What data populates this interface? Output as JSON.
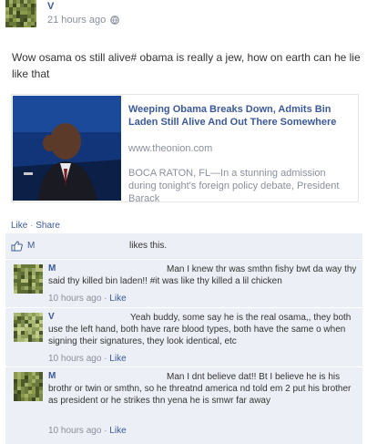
{
  "header": {
    "author": "V",
    "timestamp": "21 hours ago",
    "privacy_icon": "globe-icon"
  },
  "post": {
    "text": "Wow osama os still alive# obama is really a jew, how on earth can he lie like that"
  },
  "attachment": {
    "title": "Weeping Obama Breaks Down, Admits Bin Laden Still Alive And Out There Somewhere",
    "domain": "www.theonion.com",
    "description": "BOCA RATON, FL—In a stunning admission during tonight's foreign policy debate, President Barack"
  },
  "actions": {
    "like": "Like",
    "separator": " · ",
    "share": "Share"
  },
  "likes": {
    "icon": "thumbs-up-icon",
    "name": "M",
    "suffix": "likes this."
  },
  "comments": [
    {
      "author": "M",
      "text": "Man I knew thr was smthn fishy bwt da way thy said thy killed bin laden!! #it was like thy killed a lil chicken",
      "time": "10 hours ago",
      "sep": " · ",
      "like": "Like"
    },
    {
      "author": "V",
      "text": "Yeah buddy, some say he is the real osama,, they both use the left hand, both have rare blood types, both have the same o when signing their signatures, they look identical, etc",
      "time": "10 hours ago",
      "sep": " · ",
      "like": "Like"
    },
    {
      "author": "M",
      "text": "Man I dnt believe dat!! Bt I believe he is his brothr or twin or smthn, so he threatnd america nd told em 2 put his brother as president or he strikes thn yena he is smwr far away",
      "time": "10 hours ago",
      "sep": " · ",
      "like": "Like"
    }
  ],
  "colors": {
    "link": "#3b5998",
    "meta": "#898f9c",
    "ufi_bg": "#eceff5"
  }
}
